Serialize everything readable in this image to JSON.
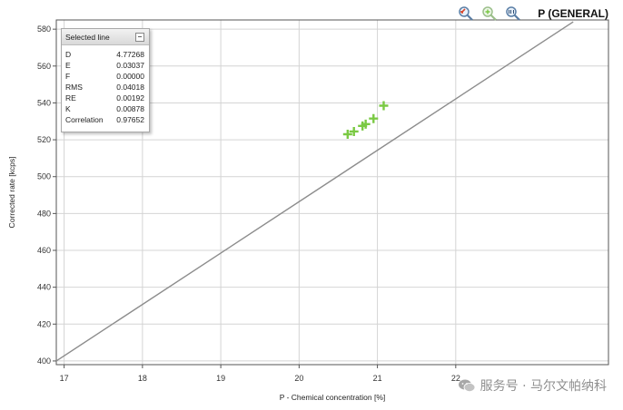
{
  "toolbar": {
    "title": "P (GENERAL)",
    "buttons": [
      {
        "icon": "zoom-out-icon"
      },
      {
        "icon": "zoom-in-icon"
      },
      {
        "icon": "zoom-reset-icon"
      }
    ]
  },
  "stats": {
    "header": "Selected line",
    "rows": [
      {
        "label": "D",
        "value": "4.77268"
      },
      {
        "label": "E",
        "value": "0.03037"
      },
      {
        "label": "F",
        "value": "0.00000"
      },
      {
        "label": "RMS",
        "value": "0.04018"
      },
      {
        "label": "RE",
        "value": "0.00192"
      },
      {
        "label": "K",
        "value": "0.00878"
      },
      {
        "label": "Correlation",
        "value": "0.97652"
      }
    ]
  },
  "watermark": {
    "text": "服务号 · 马尔文帕纳科",
    "icon": "wechat-icon"
  },
  "colors": {
    "line": "#8c8c8c",
    "points": "#7ac943",
    "grid": "#d4d4d4",
    "axis": "#555555"
  },
  "chart_data": {
    "type": "scatter",
    "title": "P (GENERAL)",
    "xlabel": "P - Chemical concentration [%]",
    "ylabel": "Corrected rate [kcps]",
    "xlim": [
      16.9,
      23.95
    ],
    "ylim": [
      398,
      585
    ],
    "xticks": [
      17,
      18,
      19,
      20,
      21,
      22
    ],
    "yticks": [
      400,
      420,
      440,
      460,
      480,
      500,
      520,
      540,
      560,
      580
    ],
    "grid": true,
    "series": [
      {
        "kind": "points",
        "x": [
          20.62,
          20.7,
          20.81,
          20.85,
          20.95,
          21.08
        ],
        "y": [
          523,
          524.5,
          527.5,
          528.5,
          531.5,
          538.5
        ]
      },
      {
        "kind": "fit-line",
        "x": [
          16.9,
          23.5
        ],
        "y": [
          400,
          584
        ]
      }
    ]
  }
}
